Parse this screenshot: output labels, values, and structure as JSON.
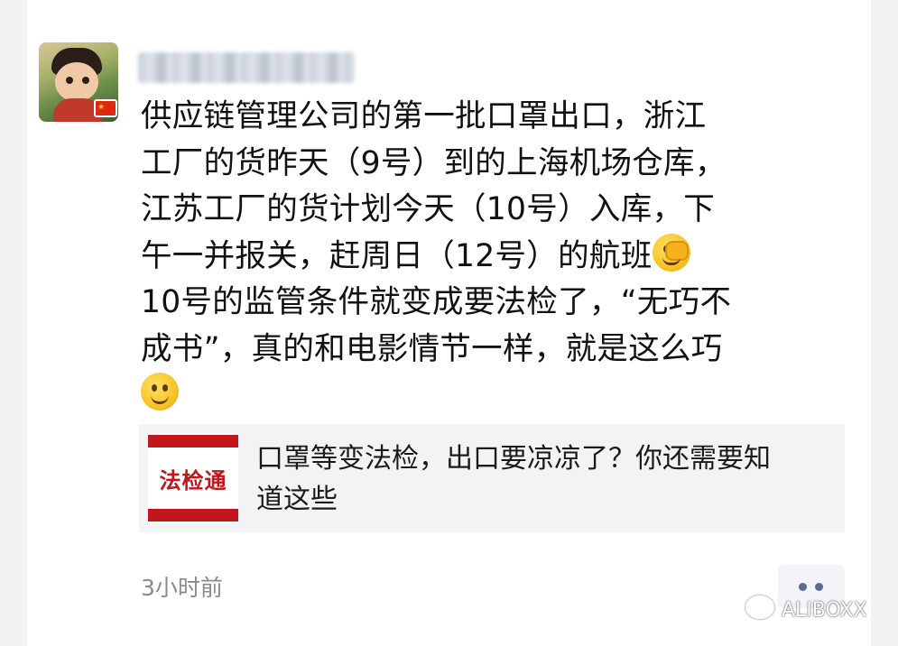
{
  "post": {
    "author_name_blurred": true,
    "text_lines": [
      "供应链管理公司的第一批口罩出口，浙江",
      "工厂的货昨天（9号）到的上海机场仓库，",
      "江苏工厂的货计划今天（10号）入库，下",
      "午一并报关，赶周日（12号）的航班",
      "10号的监管条件就变成要法检了，“无巧不",
      "成书”，真的和电影情节一样，就是这么巧"
    ],
    "emojis": [
      "facepalm-emoji",
      "smile-emoji"
    ],
    "flag_icon": "china-flag-icon"
  },
  "link_card": {
    "thumbnail_text": "法检通",
    "title_lines": [
      "口罩等变法检，出口要凉凉了？你还需要知",
      "道这些"
    ],
    "accent_color": "#c3161c"
  },
  "meta": {
    "timestamp": "3小时前",
    "more_icon": "more-dots-icon"
  },
  "watermark": {
    "text": "ALIBOXX"
  }
}
